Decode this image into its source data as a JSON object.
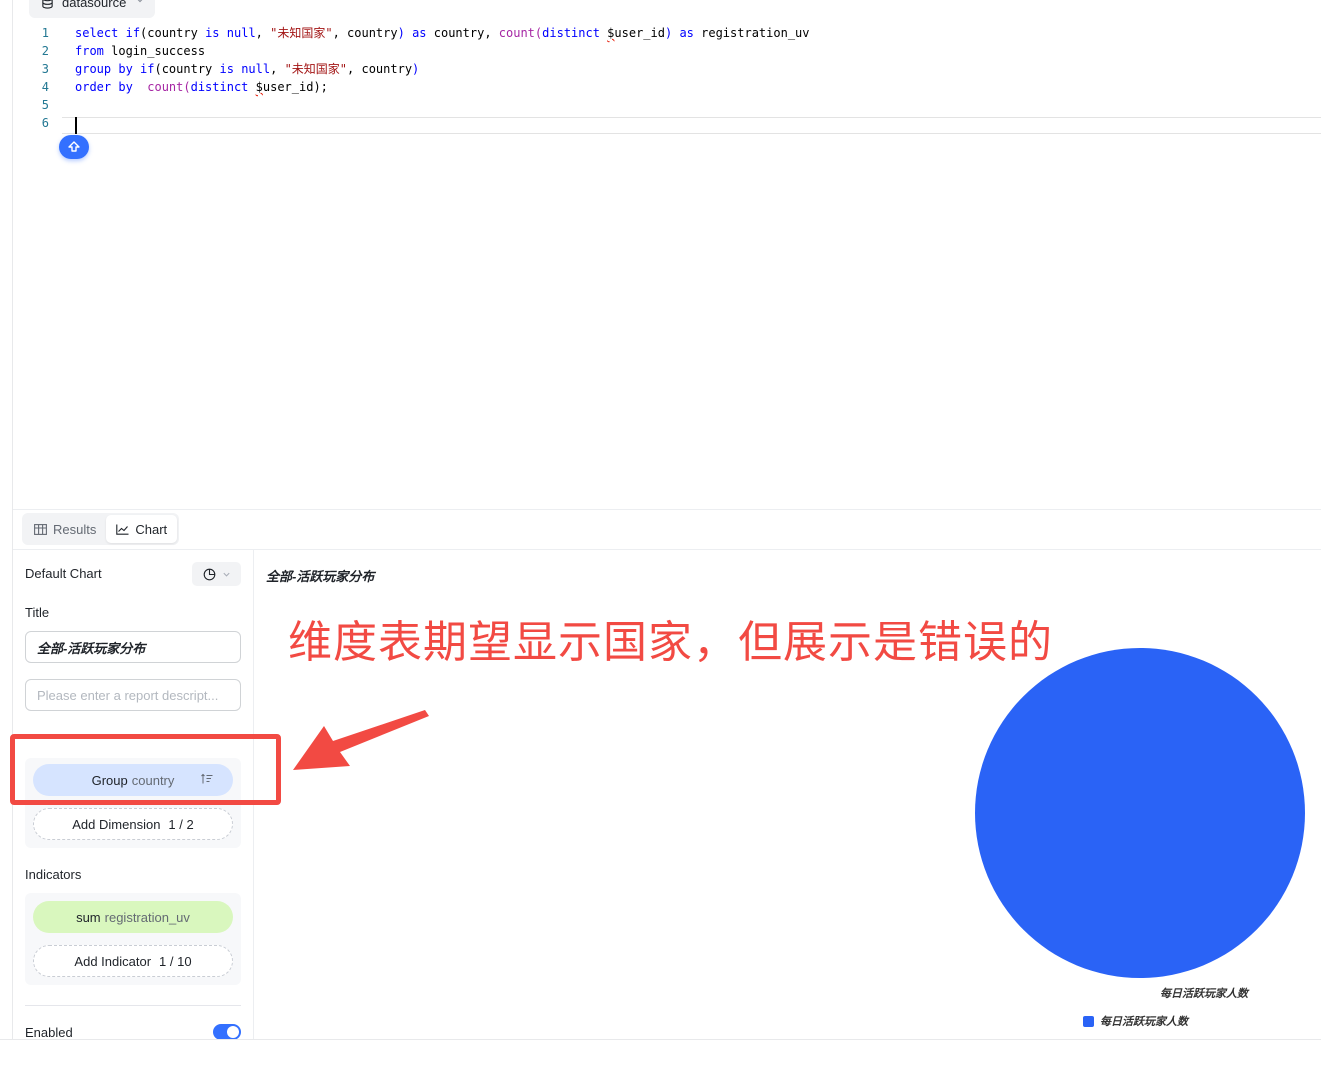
{
  "datasource": {
    "label": "datasource"
  },
  "editor": {
    "line_numbers": [
      "1",
      "2",
      "3",
      "4",
      "5",
      "6"
    ],
    "lines": [
      {
        "parts": [
          {
            "t": "select",
            "c": "k"
          },
          {
            "t": " "
          },
          {
            "t": "if",
            "c": "k"
          },
          {
            "t": "(country "
          },
          {
            "t": "is",
            "c": "k"
          },
          {
            "t": " "
          },
          {
            "t": "null",
            "c": "k"
          },
          {
            "t": ", "
          },
          {
            "t": "\"未知国家\"",
            "c": "s"
          },
          {
            "t": ", country"
          },
          {
            "t": ")",
            "c": "k"
          },
          {
            "t": " "
          },
          {
            "t": "as",
            "c": "k"
          },
          {
            "t": " country, "
          },
          {
            "t": "count",
            "c": "f"
          },
          {
            "t": "(",
            "c": "f"
          },
          {
            "t": "distinct",
            "c": "k"
          },
          {
            "t": " "
          },
          {
            "t": "$",
            "c": "sq"
          },
          {
            "t": "user_id"
          },
          {
            "t": ")",
            "c": "k"
          },
          {
            "t": " "
          },
          {
            "t": "as",
            "c": "k"
          },
          {
            "t": " registration_uv"
          }
        ]
      },
      {
        "parts": [
          {
            "t": "from",
            "c": "k"
          },
          {
            "t": " login_success"
          }
        ]
      },
      {
        "parts": [
          {
            "t": "group by",
            "c": "k"
          },
          {
            "t": " "
          },
          {
            "t": "if",
            "c": "k"
          },
          {
            "t": "(country "
          },
          {
            "t": "is",
            "c": "k"
          },
          {
            "t": " "
          },
          {
            "t": "null",
            "c": "k"
          },
          {
            "t": ", "
          },
          {
            "t": "\"未知国家\"",
            "c": "s"
          },
          {
            "t": ", country"
          },
          {
            "t": ")",
            "c": "k"
          }
        ]
      },
      {
        "parts": [
          {
            "t": "order by",
            "c": "k"
          },
          {
            "t": "  "
          },
          {
            "t": "count",
            "c": "f"
          },
          {
            "t": "(",
            "c": "f"
          },
          {
            "t": "distinct",
            "c": "k"
          },
          {
            "t": " "
          },
          {
            "t": "$",
            "c": "sq"
          },
          {
            "t": "user_id"
          },
          {
            "t": ");"
          }
        ]
      },
      {
        "parts": []
      },
      {
        "parts": []
      }
    ]
  },
  "tabs": {
    "results": "Results",
    "chart": "Chart"
  },
  "config": {
    "chart_type_label": "Default Chart",
    "title_label": "Title",
    "title_value": "全部-活跃玩家分布",
    "description_placeholder": "Please enter a report descript...",
    "dimension": {
      "prefix": "Group",
      "field": "country"
    },
    "add_dimension": {
      "label": "Add Dimension",
      "count": "1 / 2"
    },
    "indicators_label": "Indicators",
    "indicator": {
      "agg": "sum",
      "field": "registration_uv"
    },
    "add_indicator": {
      "label": "Add Indicator",
      "count": "1 / 10"
    },
    "enabled_label": "Enabled",
    "enabled": true
  },
  "annotation": {
    "text": "维度表期望显示国家，但展示是错误的"
  },
  "chart_data": {
    "type": "pie",
    "title": "全部-活跃玩家分布",
    "slices": [
      {
        "name": "每日活跃玩家人数",
        "value": 1
      }
    ],
    "colors": [
      "#2a63f6"
    ],
    "legend": [
      "每日活跃玩家人数"
    ],
    "legend_position": "bottom-right"
  }
}
